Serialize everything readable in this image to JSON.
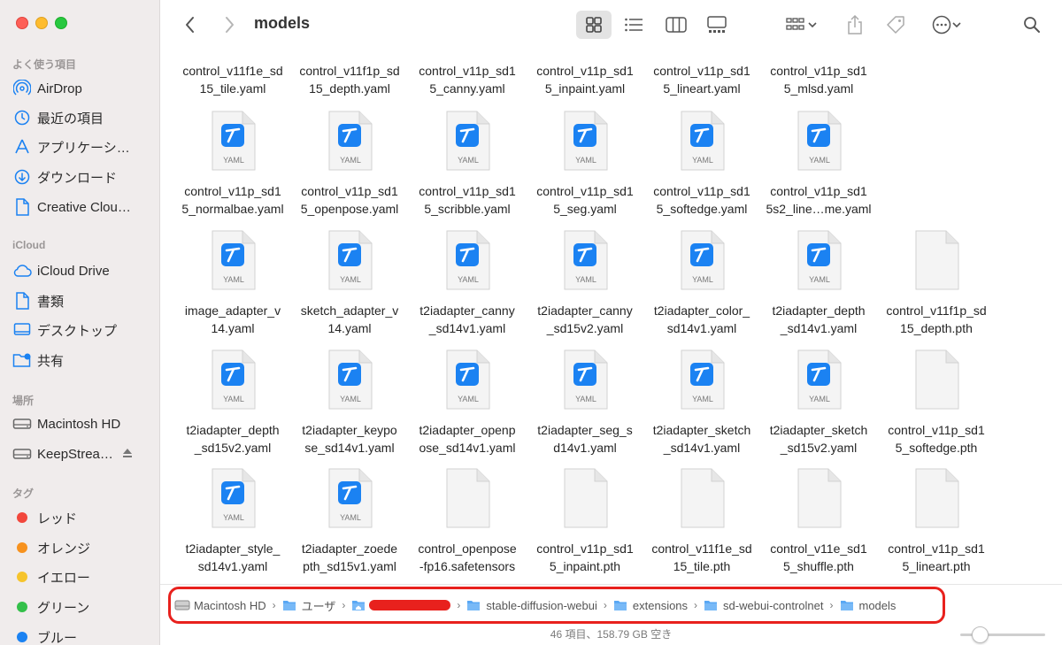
{
  "window": {
    "title": "models"
  },
  "sidebar": {
    "favorites_header": "よく使う項目",
    "favorites": [
      {
        "label": "AirDrop",
        "icon": "airdrop-icon"
      },
      {
        "label": "最近の項目",
        "icon": "clock-icon"
      },
      {
        "label": "アプリケーシ…",
        "icon": "applications-icon"
      },
      {
        "label": "ダウンロード",
        "icon": "download-icon"
      },
      {
        "label": "Creative Clou…",
        "icon": "document-icon"
      }
    ],
    "icloud_header": "iCloud",
    "icloud": [
      {
        "label": "iCloud Drive",
        "icon": "cloud-icon"
      },
      {
        "label": "書類",
        "icon": "document-icon"
      },
      {
        "label": "デスクトップ",
        "icon": "desktop-icon"
      },
      {
        "label": "共有",
        "icon": "shared-folder-icon"
      }
    ],
    "locations_header": "場所",
    "locations": [
      {
        "label": "Macintosh HD",
        "icon": "drive-icon"
      },
      {
        "label": "KeepStrea…",
        "icon": "drive-icon"
      }
    ],
    "tags_header": "タグ",
    "tags": [
      {
        "label": "レッド",
        "color": "#f2473c"
      },
      {
        "label": "オレンジ",
        "color": "#f7921e"
      },
      {
        "label": "イエロー",
        "color": "#f6c42c"
      },
      {
        "label": "グリーン",
        "color": "#34c04a"
      },
      {
        "label": "ブルー",
        "color": "#1b82f2"
      }
    ]
  },
  "files": [
    {
      "line1": "control_v11f1e_sd",
      "line2": "15_tile.yaml",
      "type": "yaml"
    },
    {
      "line1": "control_v11f1p_sd",
      "line2": "15_depth.yaml",
      "type": "yaml"
    },
    {
      "line1": "control_v11p_sd1",
      "line2": "5_canny.yaml",
      "type": "yaml"
    },
    {
      "line1": "control_v11p_sd1",
      "line2": "5_inpaint.yaml",
      "type": "yaml"
    },
    {
      "line1": "control_v11p_sd1",
      "line2": "5_lineart.yaml",
      "type": "yaml"
    },
    {
      "line1": "control_v11p_sd1",
      "line2": "5_mlsd.yaml",
      "type": "yaml"
    },
    {
      "line1": "control_v11p_sd1",
      "line2": "5_normalbae.yaml",
      "type": "yaml"
    },
    {
      "line1": "control_v11p_sd1",
      "line2": "5_openpose.yaml",
      "type": "yaml"
    },
    {
      "line1": "control_v11p_sd1",
      "line2": "5_scribble.yaml",
      "type": "yaml"
    },
    {
      "line1": "control_v11p_sd1",
      "line2": "5_seg.yaml",
      "type": "yaml"
    },
    {
      "line1": "control_v11p_sd1",
      "line2": "5_softedge.yaml",
      "type": "yaml"
    },
    {
      "line1": "control_v11p_sd1",
      "line2": "5s2_line…me.yaml",
      "type": "yaml"
    },
    {
      "line1": "image_adapter_v",
      "line2": "14.yaml",
      "type": "yaml"
    },
    {
      "line1": "sketch_adapter_v",
      "line2": "14.yaml",
      "type": "yaml"
    },
    {
      "line1": "t2iadapter_canny",
      "line2": "_sd14v1.yaml",
      "type": "yaml"
    },
    {
      "line1": "t2iadapter_canny",
      "line2": "_sd15v2.yaml",
      "type": "yaml"
    },
    {
      "line1": "t2iadapter_color_",
      "line2": "sd14v1.yaml",
      "type": "yaml"
    },
    {
      "line1": "t2iadapter_depth",
      "line2": "_sd14v1.yaml",
      "type": "yaml"
    },
    {
      "line1": "control_v11f1p_sd",
      "line2": "15_depth.pth",
      "type": "blank"
    },
    {
      "line1": "t2iadapter_depth",
      "line2": "_sd15v2.yaml",
      "type": "yaml"
    },
    {
      "line1": "t2iadapter_keypo",
      "line2": "se_sd14v1.yaml",
      "type": "yaml"
    },
    {
      "line1": "t2iadapter_openp",
      "line2": "ose_sd14v1.yaml",
      "type": "yaml"
    },
    {
      "line1": "t2iadapter_seg_s",
      "line2": "d14v1.yaml",
      "type": "yaml"
    },
    {
      "line1": "t2iadapter_sketch",
      "line2": "_sd14v1.yaml",
      "type": "yaml"
    },
    {
      "line1": "t2iadapter_sketch",
      "line2": "_sd15v2.yaml",
      "type": "yaml"
    },
    {
      "line1": "control_v11p_sd1",
      "line2": "5_softedge.pth",
      "type": "blank"
    },
    {
      "line1": "t2iadapter_style_",
      "line2": "sd14v1.yaml",
      "type": "yaml"
    },
    {
      "line1": "t2iadapter_zoede",
      "line2": "pth_sd15v1.yaml",
      "type": "yaml"
    },
    {
      "line1": "control_openpose",
      "line2": "-fp16.safetensors",
      "type": "blank"
    },
    {
      "line1": "control_v11p_sd1",
      "line2": "5_inpaint.pth",
      "type": "blank"
    },
    {
      "line1": "control_v11f1e_sd",
      "line2": "15_tile.pth",
      "type": "blank"
    },
    {
      "line1": "control_v11e_sd1",
      "line2": "5_shuffle.pth",
      "type": "blank"
    },
    {
      "line1": "control_v11p_sd1",
      "line2": "5_lineart.pth",
      "type": "blank"
    }
  ],
  "yaml_badge": "YAML",
  "pathbar": {
    "crumbs": [
      {
        "label": "Macintosh HD",
        "icon": "drive-icon"
      },
      {
        "label": "ユーザ",
        "icon": "folder-icon"
      },
      {
        "label": "",
        "icon": "home-folder-icon",
        "redacted": true
      },
      {
        "label": "stable-diffusion-webui",
        "icon": "folder-icon"
      },
      {
        "label": "extensions",
        "icon": "folder-icon"
      },
      {
        "label": "sd-webui-controlnet",
        "icon": "folder-icon"
      },
      {
        "label": "models",
        "icon": "folder-icon"
      }
    ],
    "separator": "›"
  },
  "status": {
    "text": "46 項目、158.79 GB 空き"
  },
  "colors": {
    "accent": "#1b82f2",
    "highlight": "#e8211d"
  }
}
